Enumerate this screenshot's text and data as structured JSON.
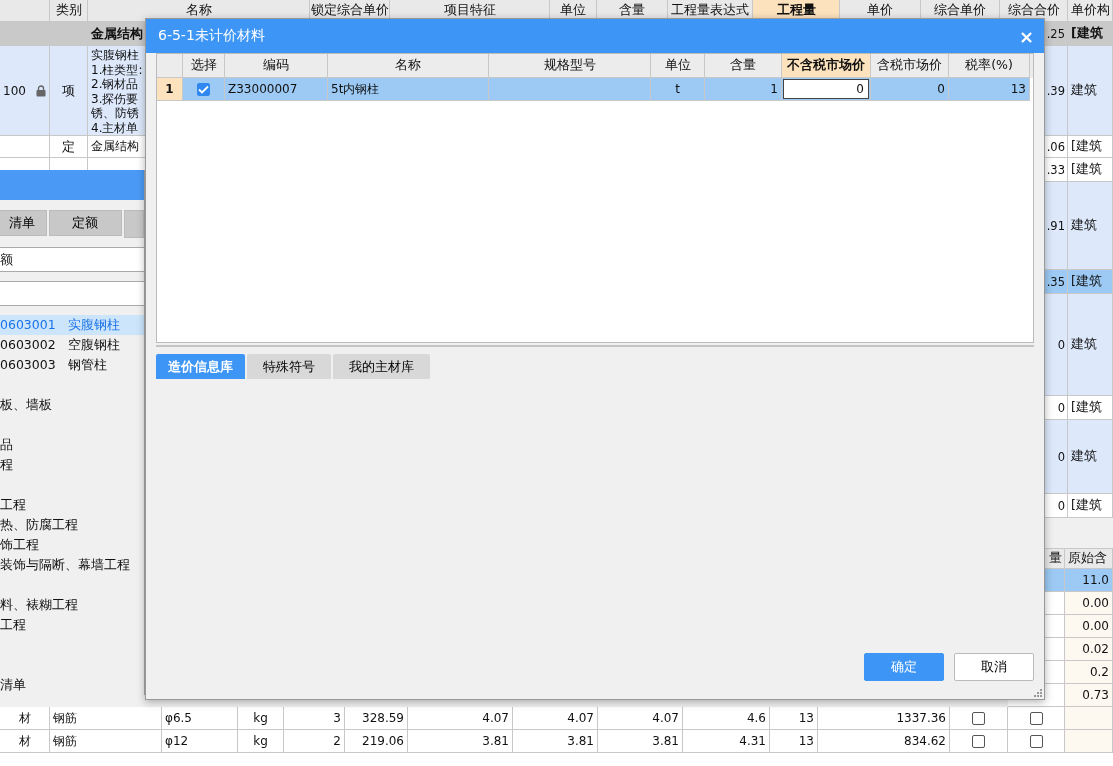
{
  "main_table": {
    "columns": [
      {
        "label": "类别",
        "selected": false
      },
      {
        "label": "名称",
        "selected": false
      },
      {
        "label": "锁定综合单价",
        "selected": false
      },
      {
        "label": "项目特征",
        "selected": false
      },
      {
        "label": "单位",
        "selected": false
      },
      {
        "label": "含量",
        "selected": false
      },
      {
        "label": "工程量表达式",
        "selected": false
      },
      {
        "label": "工程量",
        "selected": true
      },
      {
        "label": "单价",
        "selected": false
      },
      {
        "label": "综合单价",
        "selected": false
      },
      {
        "label": "综合合价",
        "selected": false
      },
      {
        "label": "单价构",
        "selected": false
      }
    ],
    "rows": [
      {
        "kind": "group",
        "selected": false,
        "name": "金属结构",
        "total": ".25",
        "composition": "[建筑"
      },
      {
        "kind": "item",
        "selected": false,
        "value": "100",
        "locked": true,
        "type": "项",
        "name_lines": [
          "实腹钢柱",
          "1.柱类型:",
          "2.钢材品",
          "3.探伤要",
          "锈、防锈",
          "4.主材单"
        ],
        "total": ".39",
        "composition": "建筑"
      },
      {
        "kind": "quota",
        "selected": false,
        "type": "定",
        "name": "金属结构",
        "total": ".06",
        "composition": "[建筑"
      },
      {
        "kind": "quota",
        "selected": false,
        "total": ".33",
        "composition": "[建筑"
      },
      {
        "kind": "item",
        "selected": false,
        "total": ".91",
        "composition": "建筑"
      },
      {
        "kind": "quota",
        "selected": true,
        "total": ".35",
        "composition": "[建筑"
      },
      {
        "kind": "item",
        "selected": false,
        "total": "0",
        "composition": "建筑"
      },
      {
        "kind": "quota",
        "selected": false,
        "total": "0",
        "composition": "[建筑"
      },
      {
        "kind": "item",
        "selected": false,
        "total": "0",
        "composition": "建筑"
      },
      {
        "kind": "quota",
        "selected": false,
        "total": "0",
        "composition": "[建筑"
      }
    ]
  },
  "side_panel": {
    "tabs": [
      {
        "label": "清单"
      },
      {
        "label": "定额"
      }
    ],
    "search": {
      "value": "额"
    },
    "list": [
      {
        "code": "0603001",
        "name": "实腹钢柱",
        "selected": true
      },
      {
        "code": "0603002",
        "name": "空腹钢柱",
        "selected": false
      },
      {
        "code": "0603003",
        "name": "钢管柱",
        "selected": false
      }
    ],
    "tree": [
      "板、墙板",
      "品",
      "程",
      "工程",
      "热、防腐工程",
      "饰工程",
      "装饰与隔断、幕墙工程",
      "料、裱糊工程",
      "工程",
      "清单"
    ]
  },
  "material_table": {
    "columns": [
      "量",
      "原始含"
    ],
    "rows": [
      {
        "value": "11.0",
        "selected": true
      },
      {
        "value": "0.00",
        "selected": false
      },
      {
        "value": "0.00",
        "selected": false
      },
      {
        "value": "0.02",
        "selected": false
      },
      {
        "value": "0.2",
        "selected": false
      },
      {
        "value": "0.73",
        "selected": false
      }
    ]
  },
  "bottom_table": {
    "rows": [
      {
        "cells": [
          "材",
          "钢筋",
          "φ6.5",
          "kg",
          "3",
          "328.59",
          "4.07",
          "4.07",
          "4.07",
          "4.6",
          "13",
          "1337.36"
        ],
        "checks": [
          false,
          false
        ]
      },
      {
        "cells": [
          "材",
          "钢筋",
          "φ12",
          "kg",
          "2",
          "219.06",
          "3.81",
          "3.81",
          "3.81",
          "4.31",
          "13",
          "834.62"
        ],
        "checks": [
          false,
          false
        ]
      }
    ]
  },
  "dialog": {
    "title": "6-5-1未计价材料",
    "close": "×",
    "columns": [
      {
        "label": "选择",
        "selected": false
      },
      {
        "label": "编码",
        "selected": false
      },
      {
        "label": "名称",
        "selected": false
      },
      {
        "label": "规格型号",
        "selected": false
      },
      {
        "label": "单位",
        "selected": false
      },
      {
        "label": "含量",
        "selected": false
      },
      {
        "label": "不含税市场价",
        "selected": true
      },
      {
        "label": "含税市场价",
        "selected": false
      },
      {
        "label": "税率(%)",
        "selected": false
      }
    ],
    "rows": [
      {
        "index": "1",
        "checked": true,
        "code": "Z33000007",
        "name": "5t内钢柱",
        "unit": "t",
        "quantity": "1",
        "price": "0",
        "tax_price": "0",
        "rate": "13",
        "selected": true
      }
    ],
    "tabs": [
      {
        "label": "造价信息库",
        "selected": true
      },
      {
        "label": "特殊符号",
        "selected": false
      },
      {
        "label": "我的主材库",
        "selected": false
      }
    ],
    "buttons": [
      {
        "label": "确定",
        "kind": "primary"
      },
      {
        "label": "取消",
        "kind": "secondary"
      }
    ]
  }
}
